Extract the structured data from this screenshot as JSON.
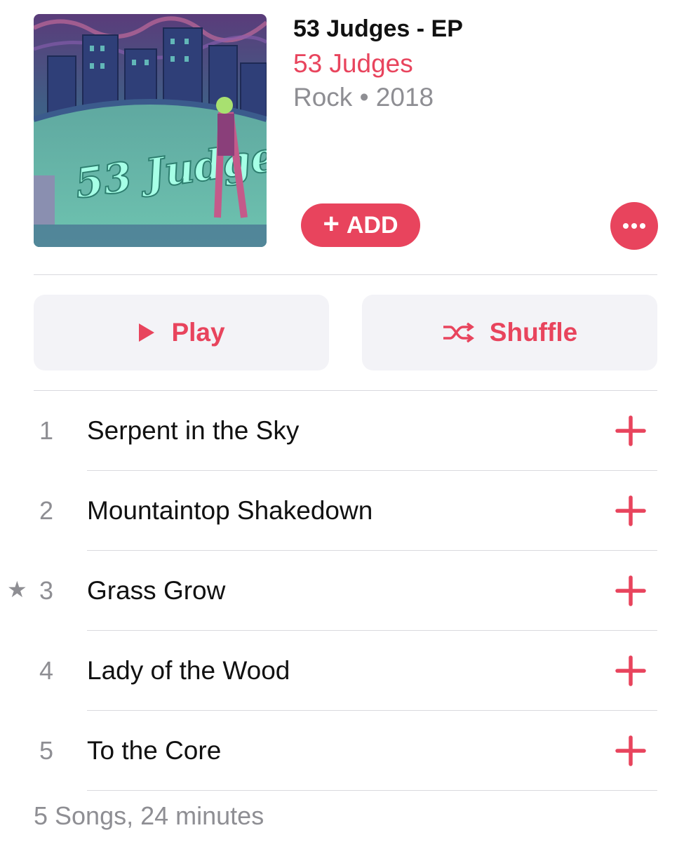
{
  "album": {
    "title": "53 Judges - EP",
    "artist": "53 Judges",
    "meta": "Rock • 2018",
    "art_caption": "53 Judges"
  },
  "actions": {
    "add_label": "ADD",
    "play_label": "Play",
    "shuffle_label": "Shuffle",
    "more_icon": "ellipsis-icon"
  },
  "tracks": [
    {
      "number": "1",
      "title": "Serpent in the Sky",
      "starred": false
    },
    {
      "number": "2",
      "title": "Mountaintop Shakedown",
      "starred": false
    },
    {
      "number": "3",
      "title": "Grass Grow",
      "starred": true,
      "star": "★"
    },
    {
      "number": "4",
      "title": "Lady of the Wood",
      "starred": false
    },
    {
      "number": "5",
      "title": "To the Core",
      "starred": false
    }
  ],
  "footer": "5 Songs, 24 minutes",
  "colors": {
    "accent": "#e8445d",
    "secondary_text": "#8e8e93",
    "button_bg": "#f3f3f7"
  }
}
